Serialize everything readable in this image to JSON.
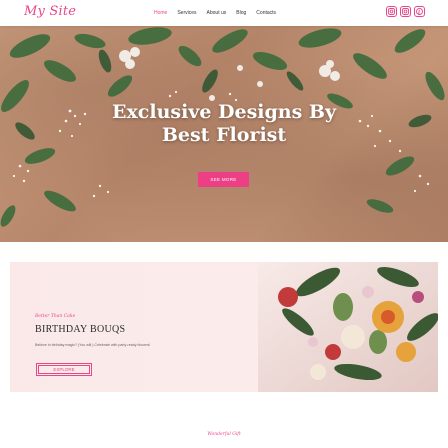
{
  "header": {
    "logo": "My Site",
    "nav": [
      "Home",
      "Services",
      "About us",
      "Blog",
      "Contacts"
    ],
    "social": [
      "instagram-icon",
      "instagram-icon",
      "pinterest-icon"
    ]
  },
  "hero": {
    "title_line1": "Exclusive Designs By",
    "title_line2": "Best Florist",
    "button": "SEE MORE"
  },
  "promo": {
    "subtitle": "Better Than Cake",
    "title": "BIRTHDAY BOUQS",
    "description": "Believe in birthday magic? (You will.) Celebrate with party-ready blooms!",
    "button": "EXPLORE"
  },
  "next_section": {
    "subtitle": "Wonderful Gift"
  },
  "colors": {
    "accent": "#e8488a",
    "button": "#ec3f86",
    "promo_bg": "#fbe9ea"
  }
}
